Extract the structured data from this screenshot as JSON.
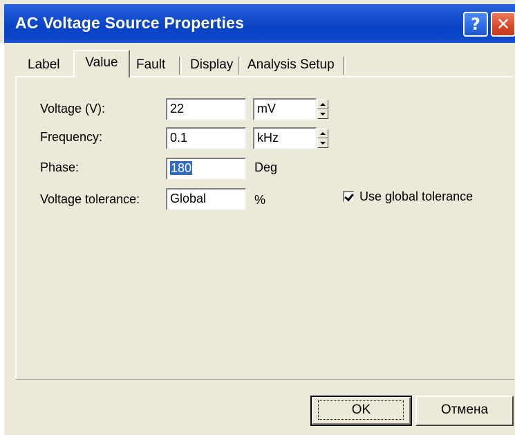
{
  "window": {
    "title": "AC Voltage Source Properties",
    "help_label": "?",
    "close_label": "✕"
  },
  "tabs": [
    {
      "label": "Label",
      "active": false
    },
    {
      "label": "Value",
      "active": true
    },
    {
      "label": "Fault",
      "active": false
    },
    {
      "label": "Display",
      "active": false
    },
    {
      "label": "Analysis Setup",
      "active": false
    }
  ],
  "form": {
    "voltage": {
      "label": "Voltage (V):",
      "value": "22",
      "unit": "mV"
    },
    "frequency": {
      "label": "Frequency:",
      "value": "0.1",
      "unit": "kHz"
    },
    "phase": {
      "label": "Phase:",
      "value": "180",
      "unit": "Deg"
    },
    "tolerance": {
      "label": "Voltage tolerance:",
      "value": "Global",
      "unit": "%"
    },
    "use_global": {
      "label": "Use global tolerance",
      "checked": true
    }
  },
  "buttons": {
    "ok": "OK",
    "cancel": "Отмена"
  },
  "colors": {
    "title_bar": "#0a43c4",
    "dialog_bg": "#ece9d8",
    "selection": "#316ac5",
    "close_button": "#d9482a"
  }
}
